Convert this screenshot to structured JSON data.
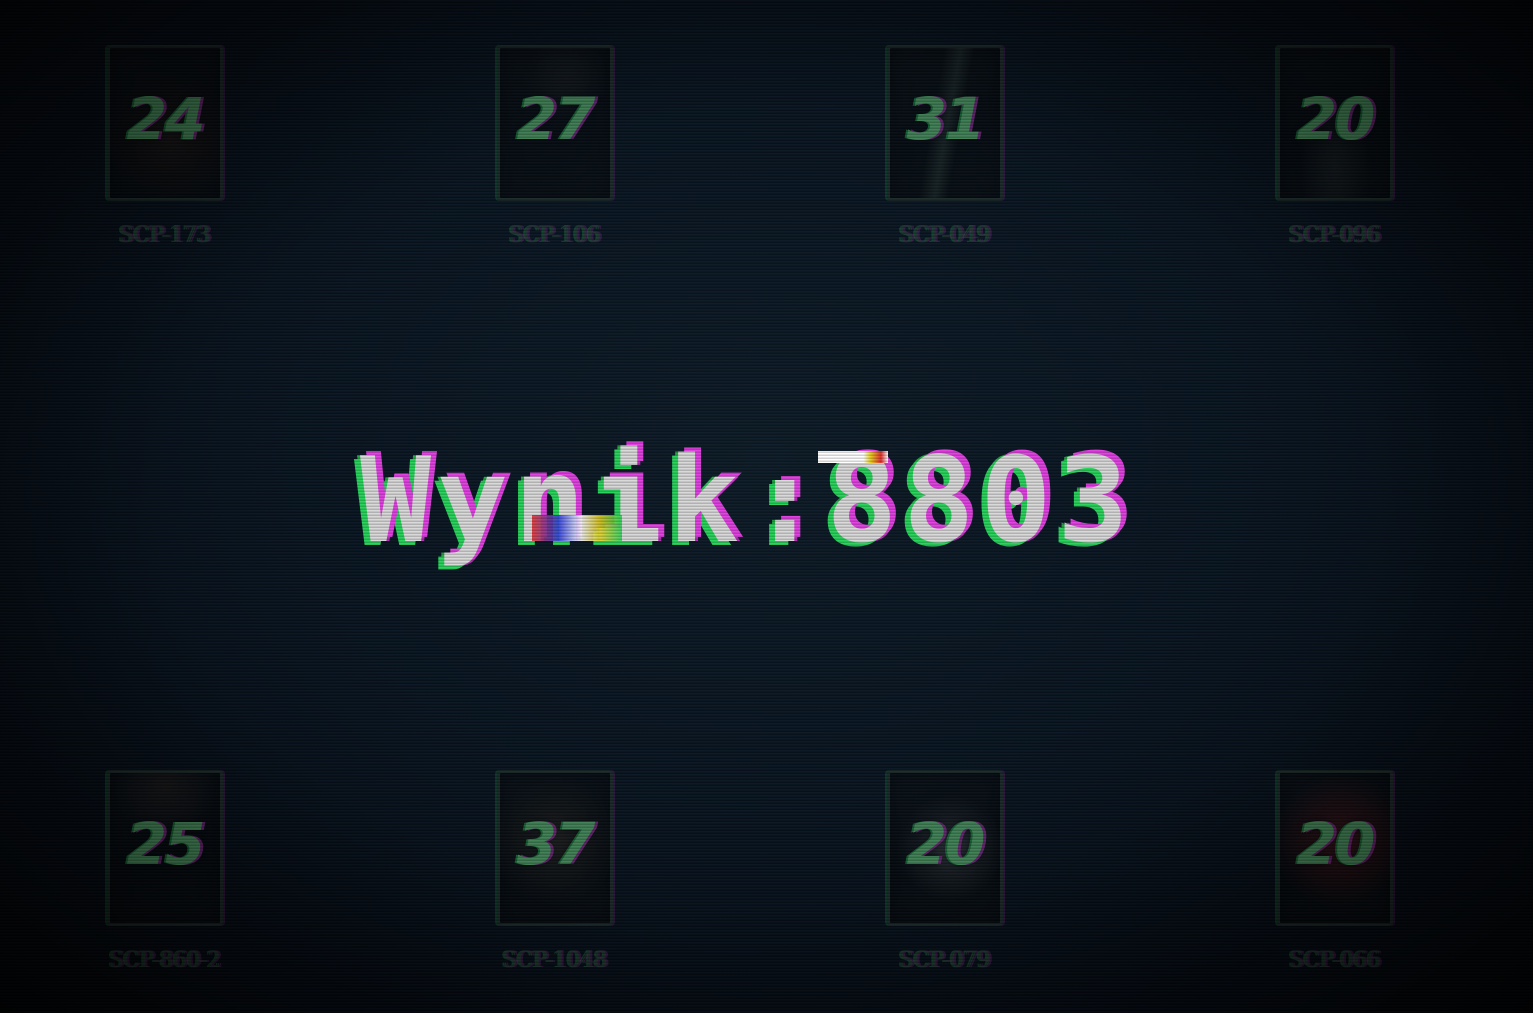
{
  "score": {
    "label": "Wynik",
    "separator": ":",
    "value": "8803"
  },
  "cards": [
    {
      "count": "24",
      "name": "SCP-173"
    },
    {
      "count": "27",
      "name": "SCP-106"
    },
    {
      "count": "31",
      "name": "SCP-049"
    },
    {
      "count": "20",
      "name": "SCP-096"
    },
    {
      "count": "25",
      "name": "SCP-860-2"
    },
    {
      "count": "37",
      "name": "SCP-1048"
    },
    {
      "count": "20",
      "name": "SCP-079"
    },
    {
      "count": "20",
      "name": "SCP-066"
    }
  ],
  "colors": {
    "accent_green": "#27d35a",
    "accent_magenta": "#e040e0",
    "score_text": "#d8d8d8",
    "background": "#081420"
  }
}
